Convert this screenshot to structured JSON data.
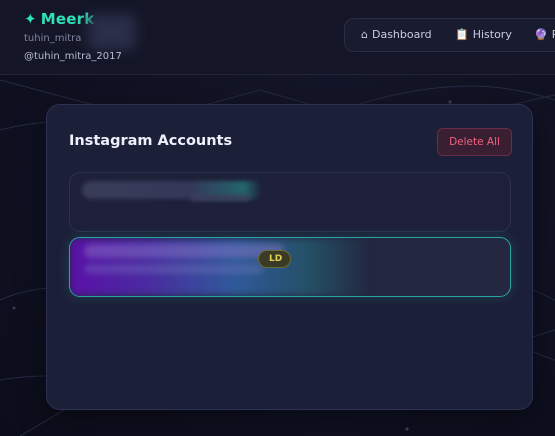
{
  "header": {
    "brand": "Meerk",
    "brand_icon": "sparkle-icon",
    "username": "tuhin_mitra",
    "handle": "@tuhin_mitra_2017",
    "accent_color": "#2fe0b8"
  },
  "nav": {
    "items": [
      {
        "label": "Dashboard",
        "icon": "home-icon",
        "glyph": "⌂"
      },
      {
        "label": "History",
        "icon": "clipboard-icon",
        "glyph": "📋"
      },
      {
        "label": "P",
        "icon": "crystal-ball-icon",
        "glyph": "🔮"
      }
    ]
  },
  "card": {
    "title": "Instagram Accounts",
    "delete_all_label": "Delete All",
    "accounts": [
      {
        "selected": false
      },
      {
        "selected": true,
        "badge": "LD"
      }
    ]
  },
  "colors": {
    "background": "#101222",
    "card": "#1c1f38",
    "danger": "#f0637e",
    "selected_border": "#2aa4a0",
    "badge_text": "#e3d25a"
  }
}
